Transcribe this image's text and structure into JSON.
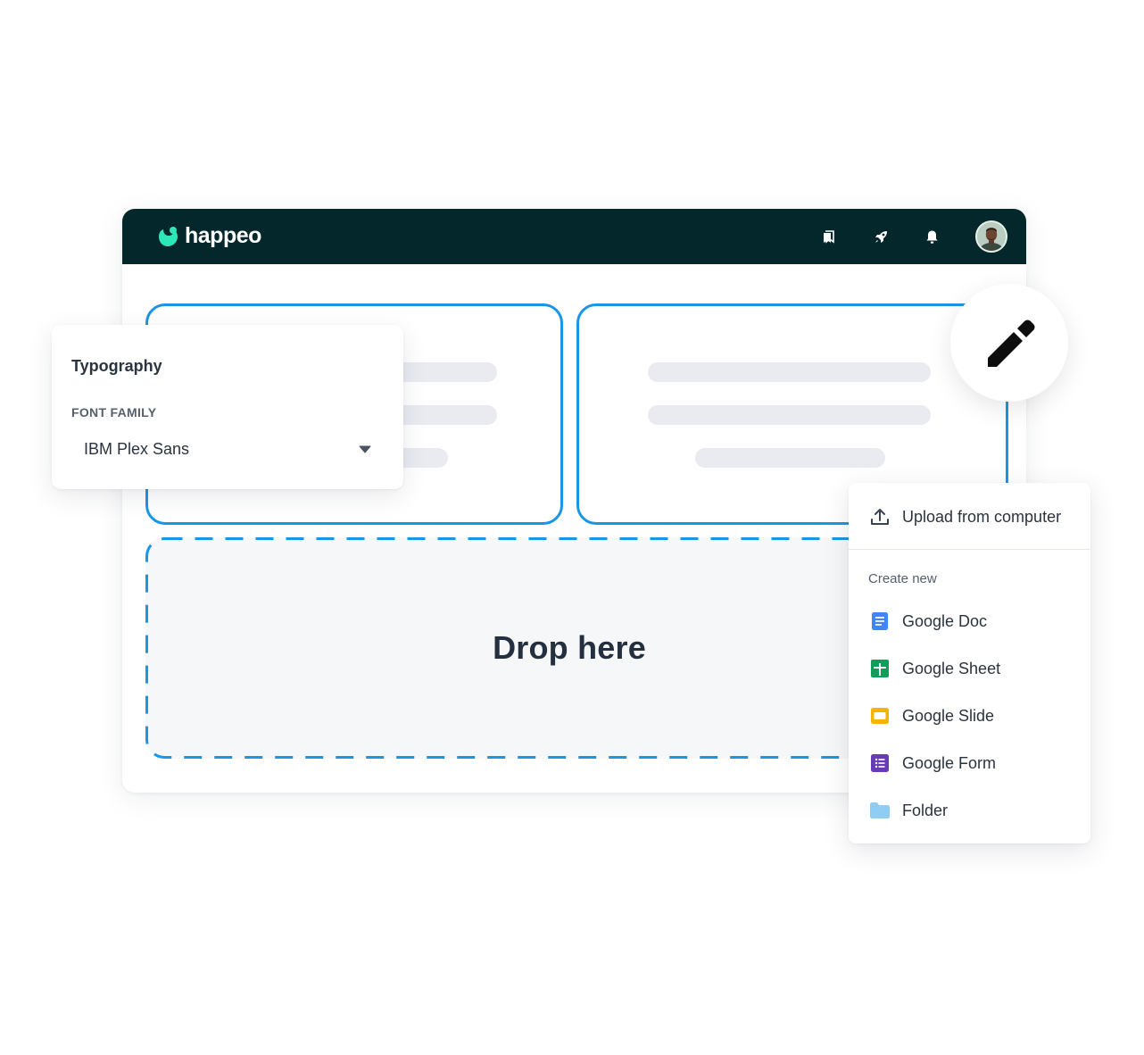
{
  "app": {
    "name": "happeo"
  },
  "colors": {
    "topbar": "#03272a",
    "accent": "#1a96e6",
    "brand_green": "#2ee6b7",
    "skeleton": "#e9ebf1"
  },
  "topbar": {
    "icons": [
      "bookmarks-icon",
      "rocket-icon",
      "bell-icon"
    ],
    "avatar": "user-avatar"
  },
  "dropzone": {
    "label": "Drop here"
  },
  "edit_button": {
    "icon": "pencil-icon"
  },
  "typography_panel": {
    "title": "Typography",
    "font_family_label": "FONT FAMILY",
    "font_family_value": "IBM Plex Sans"
  },
  "file_menu": {
    "upload_label": "Upload from computer",
    "section_label": "Create new",
    "items": [
      {
        "label": "Google Doc",
        "icon": "google-doc-icon",
        "color": "#4285f4"
      },
      {
        "label": "Google Sheet",
        "icon": "google-sheet-icon",
        "color": "#0f9d58"
      },
      {
        "label": "Google Slide",
        "icon": "google-slide-icon",
        "color": "#f4b400"
      },
      {
        "label": "Google Form",
        "icon": "google-form-icon",
        "color": "#673ab7"
      },
      {
        "label": "Folder",
        "icon": "folder-icon",
        "color": "#8fcdf3"
      }
    ]
  }
}
